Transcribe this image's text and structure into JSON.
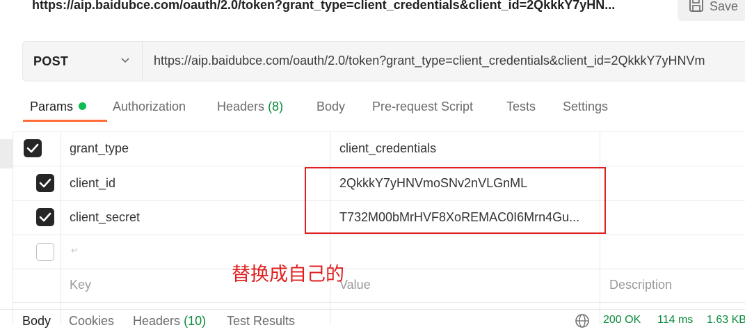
{
  "header": {
    "title_url": "https://aip.baidubce.com/oauth/2.0/token?grant_type=client_credentials&client_id=2QkkkY7yHN...",
    "save_label": "Save"
  },
  "request": {
    "method": "POST",
    "url": "https://aip.baidubce.com/oauth/2.0/token?grant_type=client_credentials&client_id=2QkkkY7yHNVm"
  },
  "tabs": [
    {
      "label": "Params",
      "active": true,
      "has_dot": true
    },
    {
      "label": "Authorization"
    },
    {
      "label": "Headers",
      "count": "(8)"
    },
    {
      "label": "Body"
    },
    {
      "label": "Pre-request Script"
    },
    {
      "label": "Tests"
    },
    {
      "label": "Settings"
    }
  ],
  "params": {
    "rows": [
      {
        "checked": true,
        "key": "grant_type",
        "value": "client_credentials"
      },
      {
        "checked": true,
        "key": "client_id",
        "value": "2QkkkY7yHNVmoSNv2nVLGnML"
      },
      {
        "checked": true,
        "key": "client_secret",
        "value": "T732M00bMrHVF8XoREMAC0I6Mrn4Gu..."
      },
      {
        "checked": false,
        "key": "",
        "value": ""
      }
    ],
    "placeholders": {
      "key": "Key",
      "value": "Value",
      "description": "Description"
    }
  },
  "annotation": "替换成自己的",
  "bottom": {
    "tabs": [
      {
        "label": "Body",
        "active": true
      },
      {
        "label": "Cookies"
      },
      {
        "label": "Headers",
        "count": "(10)"
      },
      {
        "label": "Test Results"
      }
    ],
    "status": "200 OK",
    "time": "114 ms",
    "size": "1.63 KB"
  },
  "colors": {
    "accent": "#ff6c37",
    "status_green": "#0b8a3a",
    "annotation_red": "#e02020"
  }
}
